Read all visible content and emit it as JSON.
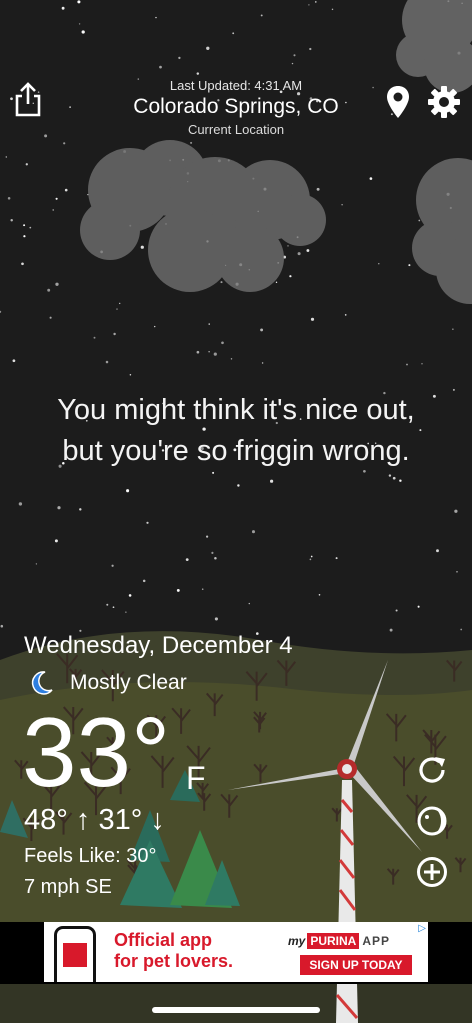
{
  "header": {
    "last_updated": "Last Updated: 4:31 AM",
    "location": "Colorado Springs, CO",
    "location_sub": "Current Location"
  },
  "icons": {
    "share": "share-icon",
    "location": "location-pin-icon",
    "settings": "gear-icon",
    "refresh": "refresh-icon",
    "moon": "moon-icon",
    "add": "plus-circle-icon"
  },
  "tagline": {
    "line1": "You might think it's nice out,",
    "line2": "but you're so friggin wrong."
  },
  "weather": {
    "date": "Wednesday, December 4",
    "condition": "Mostly Clear",
    "temperature": "33°",
    "unit": "F",
    "hi_lo": "48° ↑ 31° ↓",
    "feels_like": "Feels Like: 30°",
    "wind": "7 mph SE"
  },
  "ad": {
    "headline_1": "Official app",
    "headline_2": "for pet lovers.",
    "brand_prefix": "my",
    "brand_name": "PURINA",
    "brand_suffix": "APP",
    "cta": "SIGN UP TODAY",
    "ad_marker": "▷"
  },
  "colors": {
    "sky": "#1c1c1c",
    "grass": "#4a4d2b",
    "accent_red": "#d8192b",
    "text": "#ffffff"
  }
}
